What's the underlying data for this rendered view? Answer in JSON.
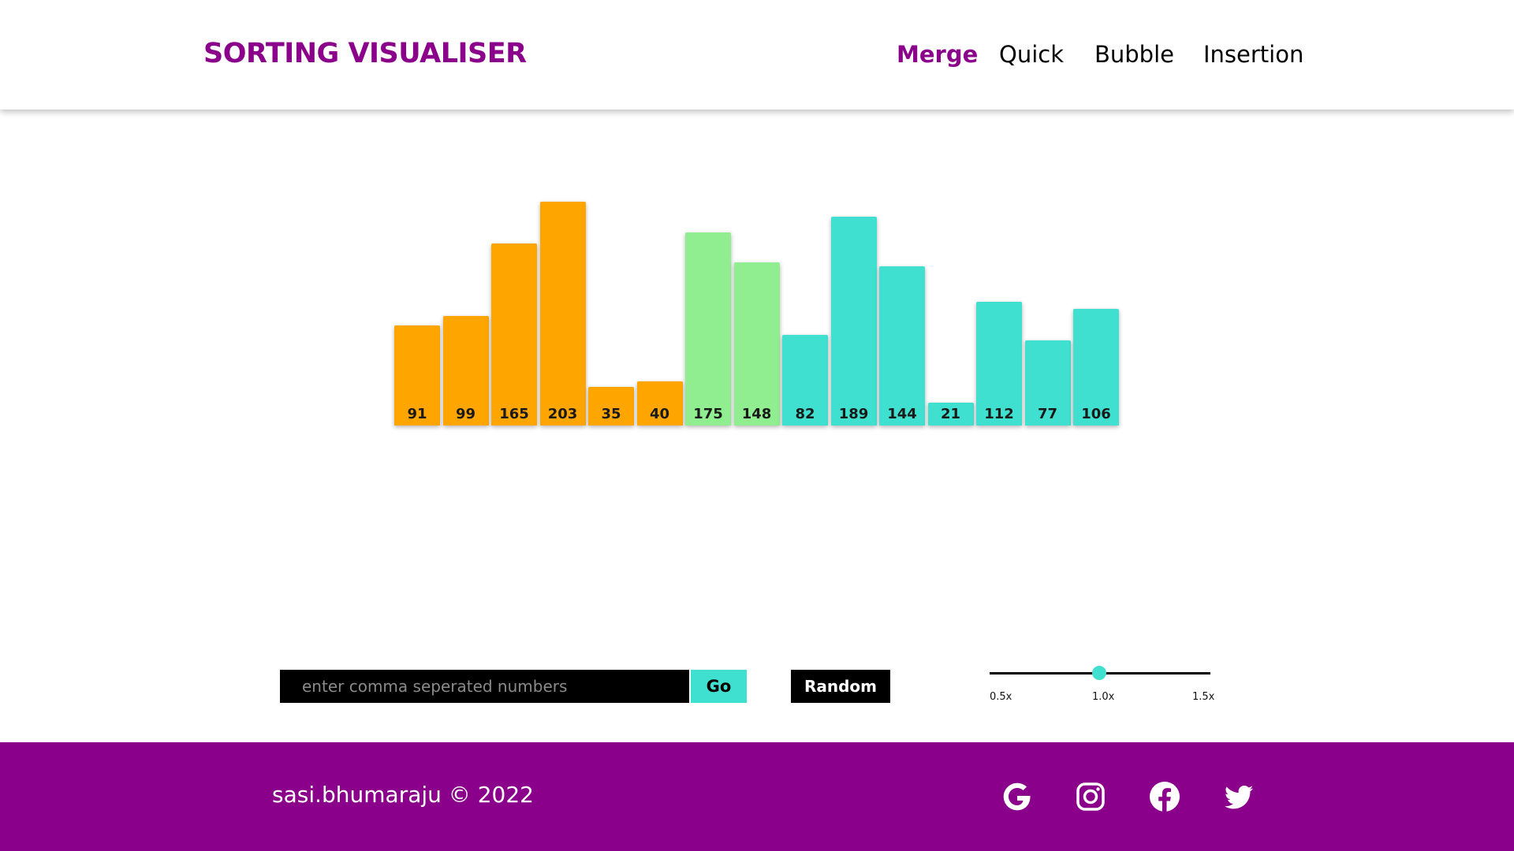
{
  "header": {
    "brand": "SORTING VISUALISER",
    "nav": [
      {
        "label": "Merge",
        "active": true
      },
      {
        "label": "Quick",
        "active": false
      },
      {
        "label": "Bubble",
        "active": false
      },
      {
        "label": "Insertion",
        "active": false
      }
    ]
  },
  "colors": {
    "brand": "#8b008b",
    "orange": "#ffa500",
    "green": "#90ee90",
    "turquoise": "#40e0d0"
  },
  "chart_data": {
    "type": "bar",
    "values": [
      91,
      99,
      165,
      203,
      35,
      40,
      175,
      148,
      82,
      189,
      144,
      21,
      112,
      77,
      106
    ],
    "bar_colors": [
      "orange",
      "orange",
      "orange",
      "orange",
      "orange",
      "orange",
      "green",
      "green",
      "turquoise",
      "turquoise",
      "turquoise",
      "turquoise",
      "turquoise",
      "turquoise",
      "turquoise"
    ]
  },
  "controls": {
    "input_placeholder": "enter comma seperated numbers",
    "go_label": "Go",
    "random_label": "Random",
    "speed": {
      "ticks": [
        "0.5x",
        "1.0x",
        "1.5x"
      ],
      "value": "1.0x"
    }
  },
  "footer": {
    "copyright": "sasi.bhumaraju © 2022",
    "social": [
      "google-icon",
      "instagram-icon",
      "facebook-icon",
      "twitter-icon"
    ]
  }
}
